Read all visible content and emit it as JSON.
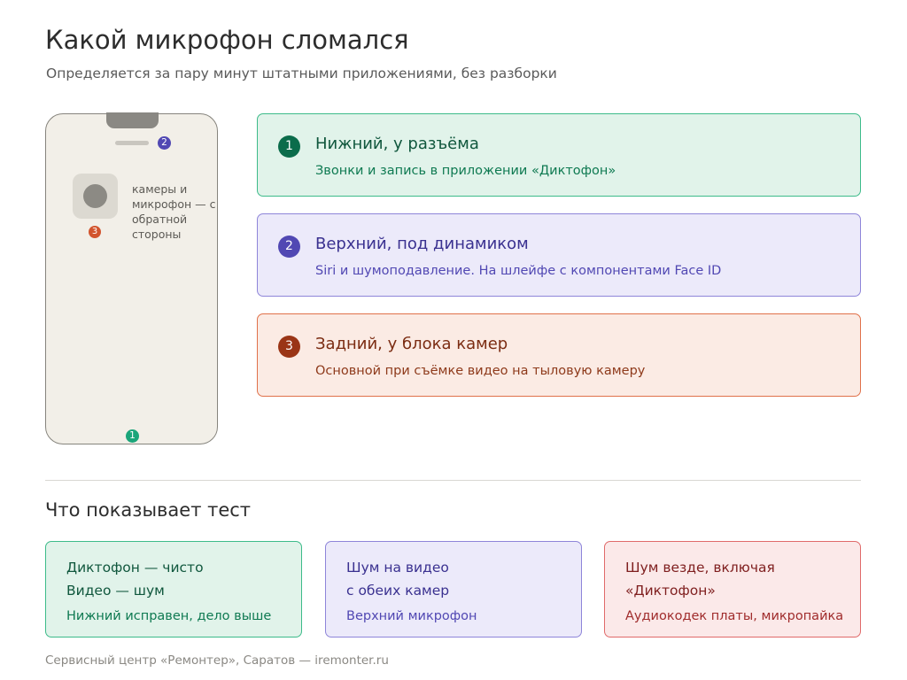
{
  "header": {
    "title": "Какой микрофон сломался",
    "subtitle": "Определяется за пару минут штатными приложениями, без разборки"
  },
  "phone": {
    "camera_note": "камеры и микрофон — с обратной стороны",
    "markers": {
      "top": "2",
      "back": "3",
      "bottom": "1"
    }
  },
  "microphones": [
    {
      "num": "1",
      "name": "Нижний, у разъёма",
      "desc": "Звонки и запись в приложении «Диктофон»",
      "color": "#0b6c4b"
    },
    {
      "num": "2",
      "name": "Верхний, под динамиком",
      "desc": "Siri и шумоподавление. На шлейфе с компонентами Face ID",
      "color": "#5148b3"
    },
    {
      "num": "3",
      "name": "Задний, у блока камер",
      "desc": "Основной при съёмке видео на тыловую камеру",
      "color": "#9a3516"
    }
  ],
  "test_section": {
    "title": "Что показывает тест",
    "results": [
      {
        "line1": "Диктофон — чисто",
        "line2": "Видео — шум",
        "verdict": "Нижний исправен, дело выше"
      },
      {
        "line1": "Шум на видео",
        "line2": "с обеих камер",
        "verdict": "Верхний микрофон"
      },
      {
        "line1": "Шум везде, включая",
        "line2": "«Диктофон»",
        "verdict": "Аудиокодек платы, микропайка"
      }
    ]
  },
  "footer": "Сервисный центр «Ремонтер», Саратов — iremonter.ru"
}
